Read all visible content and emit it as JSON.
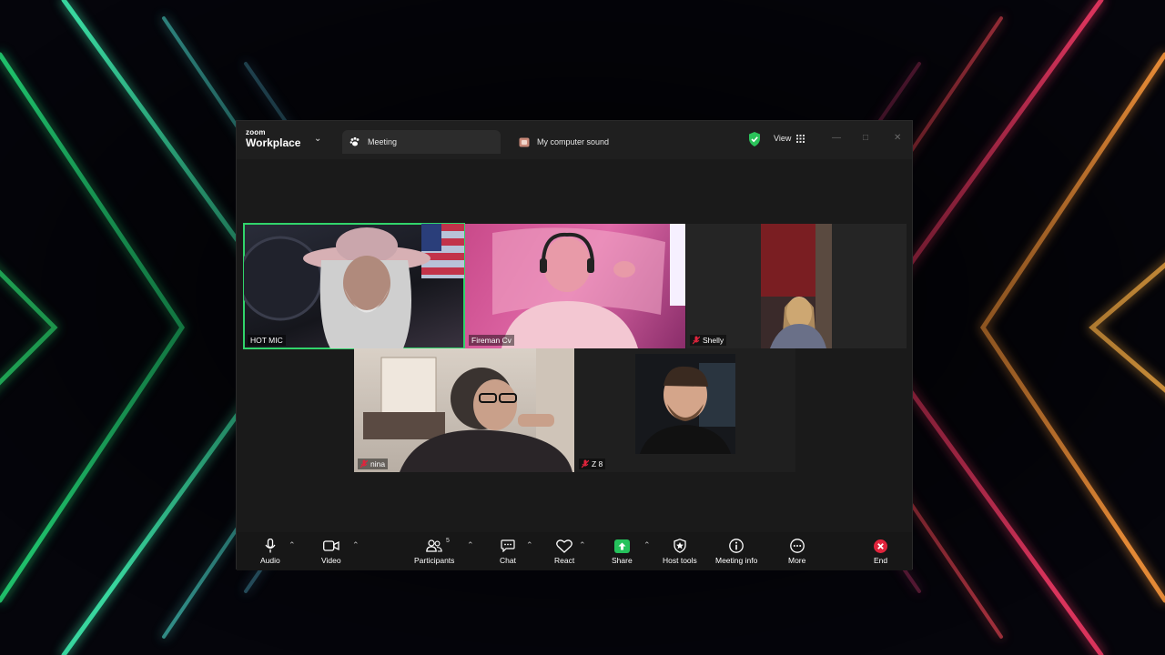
{
  "app": {
    "brand_top": "zoom",
    "brand_bottom": "Workplace"
  },
  "tabs": [
    {
      "label": "Meeting"
    },
    {
      "label": "My computer sound"
    }
  ],
  "header": {
    "view_label": "View"
  },
  "participants": [
    {
      "name": "HOT MIC",
      "muted": false,
      "active_speaker": true
    },
    {
      "name": "Fireman Cv",
      "muted": false
    },
    {
      "name": "Shelly",
      "muted": true
    },
    {
      "name": "nina",
      "muted": true
    },
    {
      "name": "Z 8",
      "muted": true
    }
  ],
  "toolbar": {
    "audio": "Audio",
    "video": "Video",
    "participants": "Participants",
    "participants_count": "5",
    "chat": "Chat",
    "react": "React",
    "share": "Share",
    "host_tools": "Host tools",
    "meeting_info": "Meeting info",
    "more": "More",
    "end": "End"
  },
  "colors": {
    "active_speaker": "#31d46b",
    "share_green": "#25c25c",
    "end_red": "#e0243c",
    "shield_green": "#2bc25a"
  },
  "icons": [
    "audio-mic-icon",
    "video-camera-icon",
    "participants-icon",
    "chat-icon",
    "react-heart-icon",
    "share-arrow-icon",
    "host-tools-shield-icon",
    "meeting-info-icon",
    "more-dots-icon",
    "end-x-icon"
  ]
}
